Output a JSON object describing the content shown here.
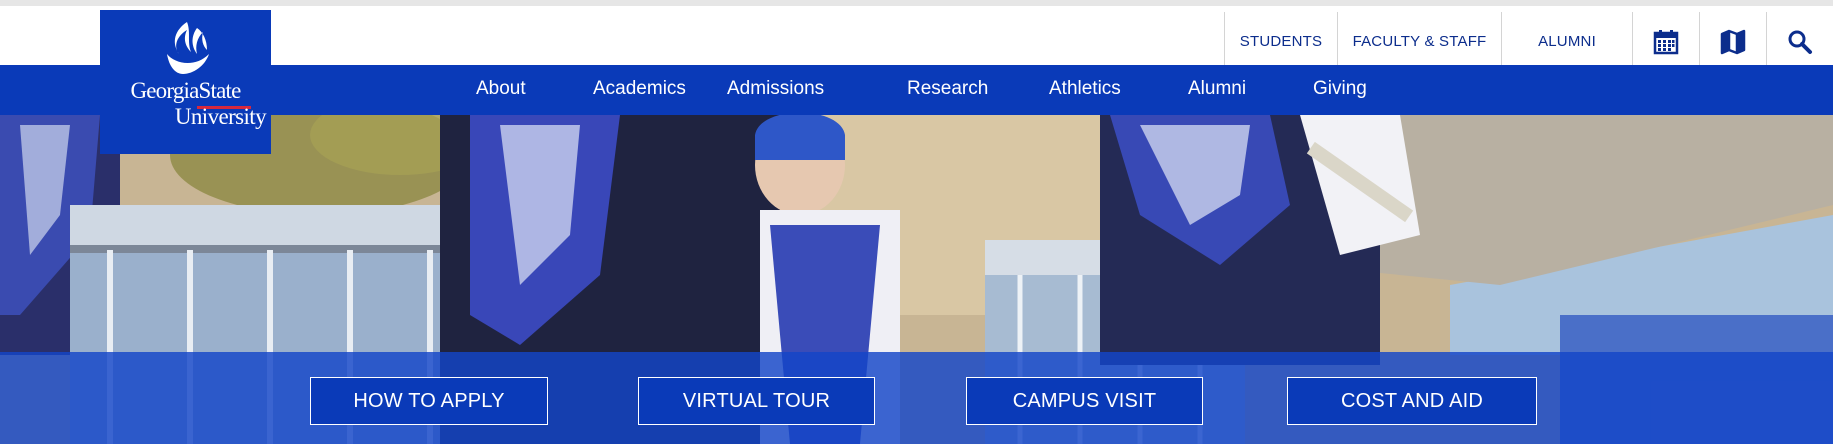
{
  "brand": {
    "name_line1": "GeorgiaState",
    "name_line2": "University",
    "color_primary": "#0a3ab8",
    "color_accent": "#d6283d",
    "logo_icon": "flame-icon"
  },
  "utility_nav": {
    "links": [
      "STUDENTS",
      "FACULTY & STAFF",
      "ALUMNI"
    ],
    "icons": [
      "calendar-icon",
      "map-icon",
      "search-icon"
    ]
  },
  "main_nav": {
    "items": [
      "About",
      "Academics",
      "Admissions",
      "Research",
      "Athletics",
      "Alumni",
      "Giving"
    ]
  },
  "hero": {
    "image": "marching-band-drumline-photo",
    "cta_buttons": [
      "HOW TO APPLY",
      "VIRTUAL TOUR",
      "CAMPUS VISIT",
      "COST AND AID"
    ]
  }
}
